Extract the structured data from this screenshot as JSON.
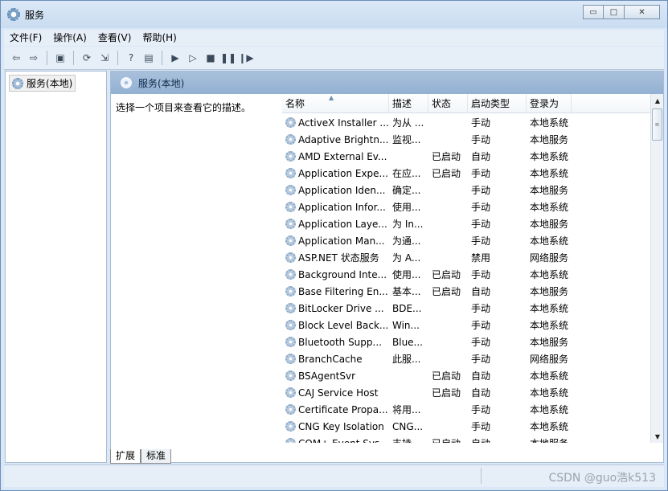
{
  "window": {
    "title": "服务"
  },
  "menu": [
    "文件(F)",
    "操作(A)",
    "查看(V)",
    "帮助(H)"
  ],
  "tree": {
    "root_label": "服务(本地)"
  },
  "pane": {
    "header_title": "服务(本地)",
    "description": "选择一个项目来查看它的描述。"
  },
  "columns": [
    "名称",
    "描述",
    "状态",
    "启动类型",
    "登录为"
  ],
  "services": [
    {
      "name": "ActiveX Installer ...",
      "desc": "为从 ...",
      "status": "",
      "startup": "手动",
      "logon": "本地系统"
    },
    {
      "name": "Adaptive Brightn...",
      "desc": "监视...",
      "status": "",
      "startup": "手动",
      "logon": "本地服务"
    },
    {
      "name": "AMD External Ev...",
      "desc": "",
      "status": "已启动",
      "startup": "自动",
      "logon": "本地系统"
    },
    {
      "name": "Application Expe...",
      "desc": "在应...",
      "status": "已启动",
      "startup": "手动",
      "logon": "本地系统"
    },
    {
      "name": "Application Iden...",
      "desc": "确定...",
      "status": "",
      "startup": "手动",
      "logon": "本地服务"
    },
    {
      "name": "Application Infor...",
      "desc": "使用...",
      "status": "",
      "startup": "手动",
      "logon": "本地系统"
    },
    {
      "name": "Application Laye...",
      "desc": "为 In...",
      "status": "",
      "startup": "手动",
      "logon": "本地服务"
    },
    {
      "name": "Application Man...",
      "desc": "为通...",
      "status": "",
      "startup": "手动",
      "logon": "本地系统"
    },
    {
      "name": "ASP.NET 状态服务",
      "desc": "为 A...",
      "status": "",
      "startup": "禁用",
      "logon": "网络服务"
    },
    {
      "name": "Background Inte...",
      "desc": "使用...",
      "status": "已启动",
      "startup": "手动",
      "logon": "本地系统"
    },
    {
      "name": "Base Filtering En...",
      "desc": "基本...",
      "status": "已启动",
      "startup": "自动",
      "logon": "本地服务"
    },
    {
      "name": "BitLocker Drive ...",
      "desc": "BDE...",
      "status": "",
      "startup": "手动",
      "logon": "本地系统"
    },
    {
      "name": "Block Level Back...",
      "desc": "Win...",
      "status": "",
      "startup": "手动",
      "logon": "本地系统"
    },
    {
      "name": "Bluetooth Supp...",
      "desc": "Blue...",
      "status": "",
      "startup": "手动",
      "logon": "本地服务"
    },
    {
      "name": "BranchCache",
      "desc": "此服...",
      "status": "",
      "startup": "手动",
      "logon": "网络服务"
    },
    {
      "name": "BSAgentSvr",
      "desc": "",
      "status": "已启动",
      "startup": "自动",
      "logon": "本地系统"
    },
    {
      "name": "CAJ Service Host",
      "desc": "",
      "status": "已启动",
      "startup": "自动",
      "logon": "本地系统"
    },
    {
      "name": "Certificate Propa...",
      "desc": "将用...",
      "status": "",
      "startup": "手动",
      "logon": "本地系统"
    },
    {
      "name": "CNG Key Isolation",
      "desc": "CNG...",
      "status": "",
      "startup": "手动",
      "logon": "本地系统"
    },
    {
      "name": "COM+ Event Sys...",
      "desc": "支持...",
      "status": "已启动",
      "startup": "自动",
      "logon": "本地服务"
    }
  ],
  "tabs": [
    "扩展",
    "标准"
  ],
  "watermark": "CSDN @guo浩k513"
}
